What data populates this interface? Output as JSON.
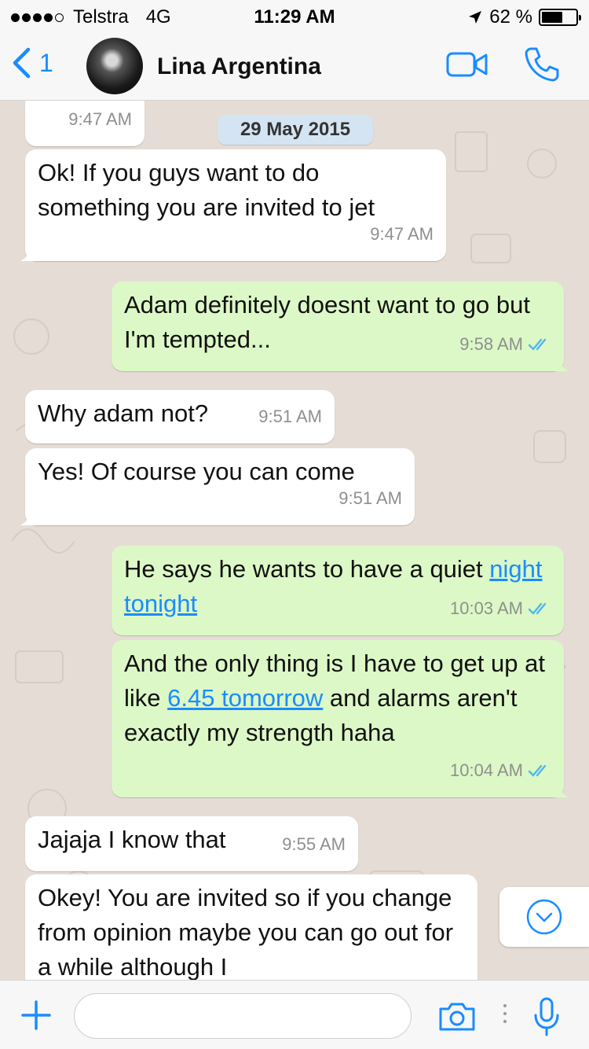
{
  "status_bar": {
    "carrier": "Telstra",
    "network": "4G",
    "time": "11:29 AM",
    "battery": "62 %",
    "battery_level": 0.62,
    "signal_bars_filled": 4,
    "signal_bars_total": 5
  },
  "header": {
    "back_count": "1",
    "contact_name": "Lina Argentina"
  },
  "chat": {
    "top_partial_time": "9:47 AM",
    "date_separator": "29 May 2015",
    "messages": [
      {
        "direction": "in",
        "text": "Ok! If you guys want to do something you are invited to jet",
        "time": "9:47 AM"
      },
      {
        "direction": "out",
        "text": "Adam definitely doesnt want to go but I'm tempted...",
        "time": "9:58 AM",
        "status": "read"
      },
      {
        "direction": "in",
        "text": "Why adam not?",
        "time": "9:51 AM"
      },
      {
        "direction": "in",
        "text": "Yes! Of course you can come",
        "time": "9:51 AM"
      },
      {
        "direction": "out",
        "text_before": "He says he wants to have a quiet ",
        "link": "night tonight",
        "text_after": "",
        "time": "10:03 AM",
        "status": "read"
      },
      {
        "direction": "out",
        "text_before": "And the only thing is I have to get up at like ",
        "link": "6.45 tomorrow",
        "text_after": " and alarms aren't exactly my strength haha",
        "time": "10:04 AM",
        "status": "read"
      },
      {
        "direction": "in",
        "text": "Jajaja I know that",
        "time": "9:55 AM"
      },
      {
        "direction": "in",
        "text": "Okey! You are invited so if you change from opinion maybe you can go out for a while although I",
        "time": ""
      }
    ]
  },
  "input_bar": {
    "placeholder": ""
  },
  "colors": {
    "accent": "#1a8cff",
    "outgoing_bubble": "#dcf8c6",
    "incoming_bubble": "#ffffff",
    "chat_background": "#e5ddd5",
    "read_ticks": "#4fb6ec",
    "date_pill": "#d5e4f3"
  },
  "icons": {
    "back": "chevron-left-icon",
    "video": "video-camera-icon",
    "call": "phone-icon",
    "attach": "plus-icon",
    "camera": "camera-icon",
    "mic": "microphone-icon",
    "scroll": "chevron-down-circle-icon",
    "location": "location-arrow-icon",
    "read": "double-check-icon"
  }
}
